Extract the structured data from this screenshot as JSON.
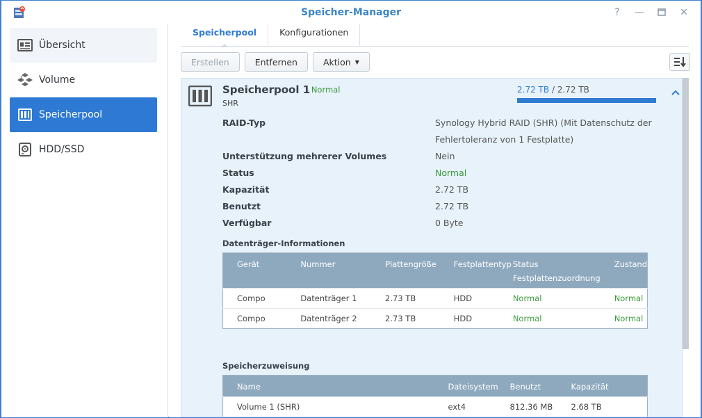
{
  "window": {
    "title": "Speicher-Manager"
  },
  "titlebar_buttons": [
    "help-icon",
    "minimize-icon",
    "maximize-icon",
    "close-icon"
  ],
  "sidebar": {
    "items": [
      {
        "label": "Übersicht",
        "icon": "overview-icon"
      },
      {
        "label": "Volume",
        "icon": "volume-icon"
      },
      {
        "label": "Speicherpool",
        "icon": "storage-pool-icon",
        "active": true
      },
      {
        "label": "HDD/SSD",
        "icon": "hdd-icon"
      }
    ]
  },
  "tabs": [
    {
      "label": "Speicherpool",
      "active": true
    },
    {
      "label": "Konfigurationen"
    }
  ],
  "toolbar": {
    "create": "Erstellen",
    "remove": "Entfernen",
    "action": "Aktion"
  },
  "pool": {
    "title": "Speicherpool 1",
    "separator": "-",
    "status": "Normal",
    "type": "SHR",
    "usage_used": "2.72 TB",
    "usage_sep": "/",
    "usage_total": "2.72 TB",
    "usage_fraction": 1.0,
    "properties": [
      {
        "key": "RAID-Typ",
        "value": "Synology Hybrid RAID (SHR) (Mit Datenschutz der Fehlertoleranz von 1 Festplatte)"
      },
      {
        "key": "Unterstützung mehrerer Volumes",
        "value": "Nein"
      },
      {
        "key": "Status",
        "value": "Normal",
        "green": true
      },
      {
        "key": "Kapazität",
        "value": "2.72 TB"
      },
      {
        "key": "Benutzt",
        "value": "2.72 TB"
      },
      {
        "key": "Verfügbar",
        "value": "0 Byte"
      }
    ]
  },
  "disks": {
    "title": "Datenträger-Informationen",
    "headers": [
      "Gerät",
      "Nummer",
      "Plattengröße",
      "Festplattentyp",
      "Status Festplattenzuordnung",
      "Zustand"
    ],
    "rows": [
      [
        "Compo",
        "Datenträger 1",
        "2.73 TB",
        "HDD",
        "Normal",
        "Normal"
      ],
      [
        "Compo",
        "Datenträger 2",
        "2.73 TB",
        "HDD",
        "Normal",
        "Normal"
      ]
    ]
  },
  "allocation": {
    "title": "Speicherzuweisung",
    "headers": [
      "Name",
      "Dateisystem",
      "Benutzt",
      "Kapazität"
    ],
    "rows": [
      [
        "Volume 1 (SHR)",
        "ext4",
        "812.36 MB",
        "2.68 TB"
      ]
    ]
  },
  "colors": {
    "accent": "#2d79d4",
    "green": "#3a9a3a",
    "title": "#3a86c8"
  }
}
